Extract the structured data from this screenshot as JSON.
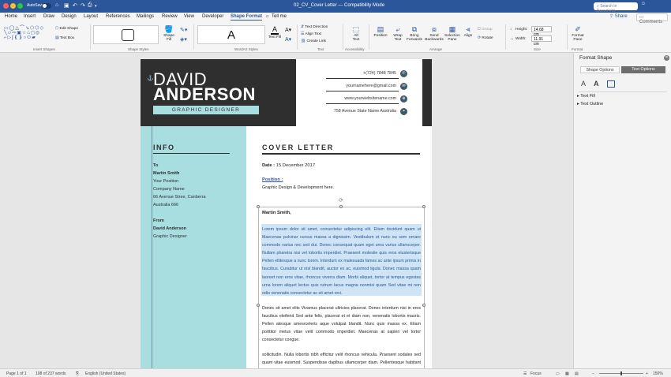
{
  "titlebar": {
    "autosave_label": "AutoSave",
    "autosave_state": "OFF",
    "document_title": "02_CV_Cover Letter  —  Compatibility Mode",
    "search_placeholder": "Search in Document",
    "colors": {
      "bar": "#2b579a"
    }
  },
  "tabs": [
    {
      "label": "Home"
    },
    {
      "label": "Insert"
    },
    {
      "label": "Draw"
    },
    {
      "label": "Design"
    },
    {
      "label": "Layout"
    },
    {
      "label": "References"
    },
    {
      "label": "Mailings"
    },
    {
      "label": "Review"
    },
    {
      "label": "View"
    },
    {
      "label": "Developer"
    },
    {
      "label": "Shape Format"
    },
    {
      "label": "Tell me"
    }
  ],
  "share_label": "Share",
  "comments_label": "Comments",
  "ribbon": {
    "edit_shape": "Edit Shape",
    "text_box": "Text Box",
    "shape_fill": "Shape\nFill",
    "text_fill": "Text Fill",
    "text_direction": "Text Direction",
    "align_text": "Align Text",
    "create_link": "Create Link",
    "alt_text": "Alt\nText",
    "position": "Position",
    "wrap_text": "Wrap\nText",
    "bring_forwards": "Bring\nForwards",
    "send_backwards": "Send\nBackwards",
    "selection_pane": "Selection\nPane",
    "align": "Align",
    "group": "Group",
    "rotate": "Rotate",
    "height_label": "Height:",
    "height_value": "14.68 cm",
    "width_label": "Width:",
    "width_value": "11.91 cm",
    "format_pane": "Format\nPane",
    "groups": {
      "insert_shapes": "Insert Shapes",
      "shape_styles": "Shape Styles",
      "wordart_styles": "WordArt Styles",
      "text": "Text",
      "accessibility": "Accessibility",
      "arrange": "Arrange",
      "size": "Size",
      "format": "Format"
    }
  },
  "document": {
    "first_name": "DAVID",
    "last_name": "ANDERSON",
    "job_title": "GRAPHIC DESIGNER",
    "contacts": [
      {
        "text": "+(724) 7848 7845",
        "icon": "phone-icon"
      },
      {
        "text": "yournamehere@gmail.com",
        "icon": "email-icon"
      },
      {
        "text": "www.yourwebsitename.com",
        "icon": "globe-icon"
      },
      {
        "text": "758 Avenue State Name Australia",
        "icon": "location-icon"
      }
    ],
    "info_heading": "INFO",
    "to_label": "To",
    "to_name": "Martin Smith",
    "to_lines": [
      "Your Position",
      "Company Name",
      "66 Avenue Stree, Canberra",
      "Australia 666"
    ],
    "from_label": "From",
    "from_name": "David Anderson",
    "from_title": "Graphic Designer",
    "cover_heading": "COVER LETTER",
    "date_label": "Date :",
    "date_value": "15 December 2017",
    "position_label": "Position :",
    "position_value": "Graphic Design & Development here.",
    "salutation": "Martin Smith,",
    "para1": "Lorem ipsum dolor sit amet, consectetur adipiscing elit. Etiam tincidunt quam ut Maecenas pulvinar cursus massa a dignissim. Vestibulum et nunc eu sem ornare commodo varius nec sed dui. Donec consequat quam eget urna varius ullamcorper. Nullam pharetra nisi vel lobortis imperdiet. Praesent molestie quis eros elusterisque Pellen ellitesque a nunc lorem. Interdum ex malesuada fames ac ante ipsum primis in faucibus. Curabitur ut nisl blandit, auctor ex ac, euismod ligula. Donec massa quam laoreet non eros vitae, rhoncus viverra diam. Morbi aliquet, tortor at tempus egestas urna lorem aliquet lectus quis rutrum lacus magna nonmisi quam Sed vitae mi non odio venenatis consectetur ac sit amet orci.",
    "para2": "Donec sit amet elits Vivamus placerat ultricies placerat. Donec interdum nisi in eros faucibus eleifend Sed ante felis, placerat et et diam non, venenatis lobortis mauris. Pellen atesque amesrceleris aque volutpat blandit. Nunc quis massa ex. Etiam porttitor metus vitae velit commodo imperdiet. Maecenas at sapien vel tortor consectetur congue.",
    "para3": "sollicitudin. Nulla lobortis nibh efficitur velit rhoncus vehicula. Praesent sodales sed quam vitae euismod. Suspendisse dapibus ullamcorper diam. Pellentesque habitant morbi tristique senectus et netus et malesuada fames ac turpis egestas.",
    "colors": {
      "dark": "#2f2f2f",
      "accent": "#a8dee0",
      "link": "#2b579a"
    }
  },
  "format_pane": {
    "title": "Format Shape",
    "tab_shape": "Shape Options",
    "tab_text": "Text Options",
    "sections": [
      "Text Fill",
      "Text Outline"
    ]
  },
  "status": {
    "page": "Page 1 of 1",
    "words": "108 of 237 words",
    "language": "English (United States)",
    "focus": "Focus",
    "zoom": "150%"
  }
}
